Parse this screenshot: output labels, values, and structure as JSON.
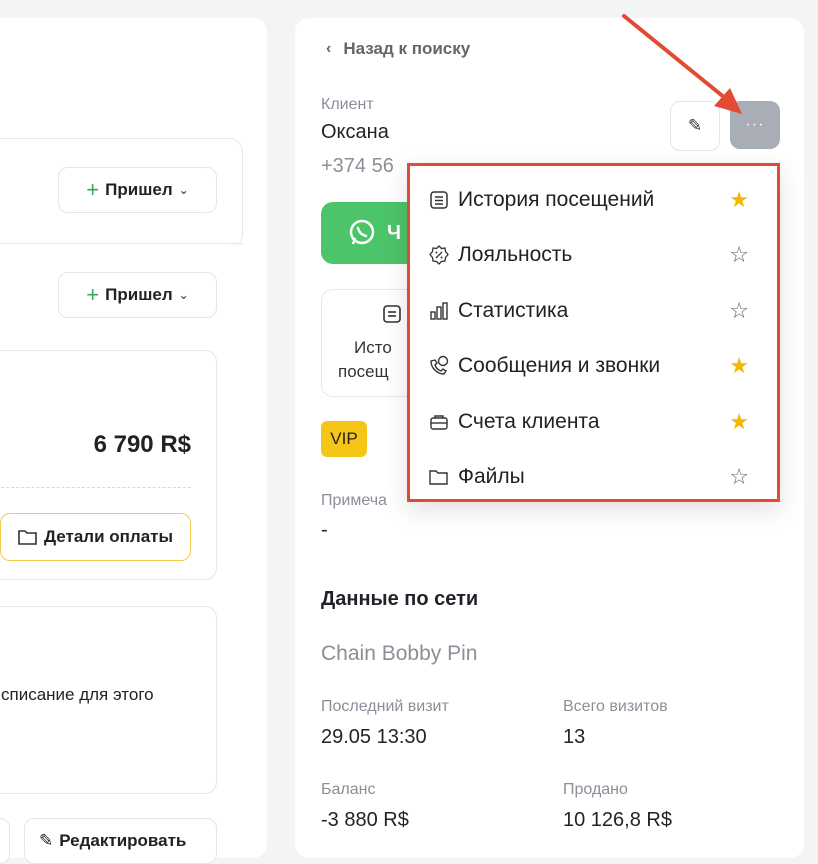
{
  "left_panel": {
    "btn_arrived_1": "Пришел",
    "btn_arrived_2": "Пришел",
    "amount": "6 790 R$",
    "payment_details": "Детали оплаты",
    "schedule_text": "списание для этого",
    "edit_button": "Редактировать"
  },
  "right_panel": {
    "back_link": "Назад к поиску",
    "client_label": "Клиент",
    "client_name": "Оксана",
    "client_phone": "+374 56",
    "whatsapp_partial": "Ч",
    "history_tile_line1": "Исто",
    "history_tile_line2": "посещ",
    "vip_badge": "VIP",
    "note_label": "Примеча",
    "note_value": "-",
    "network_title": "Данные по сети",
    "network_name": "Chain Bobby Pin",
    "last_visit_label": "Последний визит",
    "last_visit_value": "29.05 13:30",
    "total_visits_label": "Всего визитов",
    "total_visits_value": "13",
    "balance_label": "Баланс",
    "balance_value": "-3 880 R$",
    "sold_label": "Продано",
    "sold_value": "10 126,8 R$"
  },
  "dropdown": {
    "items": [
      {
        "label": "История посещений",
        "icon": "list-icon",
        "starred": true
      },
      {
        "label": "Лояльность",
        "icon": "loyalty-badge-icon",
        "starred": false
      },
      {
        "label": "Статистика",
        "icon": "bar-chart-icon",
        "starred": false
      },
      {
        "label": "Сообщения и звонки",
        "icon": "chat-phone-icon",
        "starred": true
      },
      {
        "label": "Счета клиента",
        "icon": "wallet-icon",
        "starred": true
      },
      {
        "label": "Файлы",
        "icon": "folder-icon",
        "starred": false
      }
    ]
  },
  "colors": {
    "accent_red": "#e24a33",
    "star_yellow": "#f2b705",
    "whatsapp_green": "#4cc46a",
    "vip_yellow": "#f5c518"
  }
}
